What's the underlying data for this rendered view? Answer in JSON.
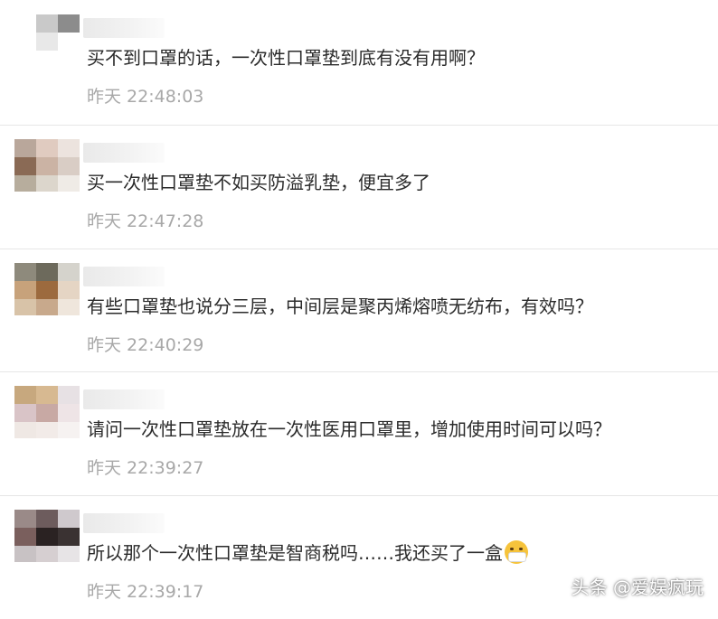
{
  "comments": [
    {
      "text": "买不到口罩的话，一次性口罩垫到底有没有用啊？",
      "time": "昨天 22:48:03",
      "avatar_colors": [
        "#ffffff",
        "#c9c9c9",
        "#8c8c8c",
        "#ffffff",
        "#e8e8e8",
        "#ffffff",
        "#ffffff",
        "#ffffff",
        "#ffffff"
      ]
    },
    {
      "text": "买一次性口罩垫不如买防溢乳垫，便宜多了",
      "time": "昨天 22:47:28",
      "avatar_colors": [
        "#b9a79b",
        "#e0cbc0",
        "#ece3de",
        "#8a6a55",
        "#cbb3a4",
        "#d9cdc5",
        "#b7ad9d",
        "#dcd6cc",
        "#efebe6"
      ]
    },
    {
      "text": "有些口罩垫也说分三层，中间层是聚丙烯熔喷无纺布，有效吗？",
      "time": "昨天 22:40:29",
      "avatar_colors": [
        "#8e8a7c",
        "#6d6a5c",
        "#d5d3cc",
        "#c7a27b",
        "#9c6a3e",
        "#e5d5c4",
        "#d8c3a8",
        "#c8a98c",
        "#efe6dc"
      ]
    },
    {
      "text": "请问一次性口罩垫放在一次性医用口罩里，增加使用时间可以吗？",
      "time": "昨天 22:39:27",
      "avatar_colors": [
        "#c7a87e",
        "#d7b991",
        "#e7e1e4",
        "#d9c4c7",
        "#c8a9a4",
        "#eee4e6",
        "#efe8e4",
        "#f2ebe8",
        "#f6f2f1"
      ]
    },
    {
      "text": "所以那个一次性口罩垫是智商税吗……我还买了一盒",
      "time": "昨天 22:39:17",
      "avatar_colors": [
        "#9a8a88",
        "#6d5c5d",
        "#cfc9cd",
        "#7a5f5d",
        "#2a2222",
        "#3a3232",
        "#c8c2c4",
        "#d6cfd1",
        "#e7e4e6"
      ]
    }
  ],
  "emoji_icon": "mask-face-emoji",
  "watermark": "头条 @爱娱疯玩"
}
